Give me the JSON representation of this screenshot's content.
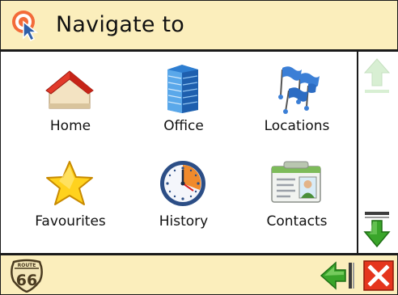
{
  "header": {
    "title": "Navigate to",
    "icon": "navigate-target-cursor-icon"
  },
  "menu": {
    "items": [
      {
        "label": "Home",
        "icon": "home-icon"
      },
      {
        "label": "Office",
        "icon": "office-building-icon"
      },
      {
        "label": "Locations",
        "icon": "locations-flags-icon"
      },
      {
        "label": "Favourites",
        "icon": "star-icon"
      },
      {
        "label": "History",
        "icon": "clock-icon"
      },
      {
        "label": "Contacts",
        "icon": "contact-card-icon"
      }
    ]
  },
  "scrollbar": {
    "up_icon": "arrow-up-icon",
    "down_icon": "arrow-down-icon",
    "up_enabled": false,
    "down_enabled": true
  },
  "footer": {
    "badge": {
      "top_text": "ROUTE",
      "number": "66"
    },
    "back_icon": "back-arrow-icon",
    "close_icon": "close-icon"
  },
  "colors": {
    "panel": "#fbeebc",
    "border": "#1a1a1a",
    "close_red": "#e5351d",
    "arrow_green": "#3aa52a"
  }
}
